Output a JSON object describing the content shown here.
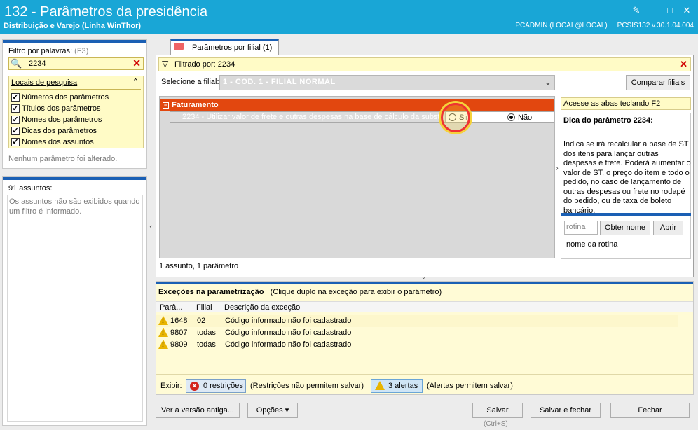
{
  "window": {
    "title": "132 - Parâmetros da presidência",
    "subtitle": "Distribuição e Varejo (Linha WinThor)",
    "user": "PCADMIN (LOCAL@LOCAL)",
    "version": "PCSIS132 v.30.1.04.004",
    "controls": [
      "✎",
      "–",
      "□",
      "✕"
    ]
  },
  "sidebar": {
    "filter_label": "Filtro por palavras:",
    "filter_shortcut": "(F3)",
    "search_value": "2234",
    "locais_title": "Locais de pesquisa",
    "locais": [
      {
        "label": "Números dos parâmetros",
        "checked": true
      },
      {
        "label": "Títulos dos parâmetros",
        "checked": true
      },
      {
        "label": "Nomes dos parâmetros",
        "checked": true
      },
      {
        "label": "Dicas dos parâmetros",
        "checked": true
      },
      {
        "label": "Nomes dos assuntos",
        "checked": true
      }
    ],
    "nenhum": "Nenhum parâmetro foi alterado.",
    "assuntos_count": "91 assuntos:",
    "assuntos_msg": "Os assuntos não são exibidos quando um filtro é informado."
  },
  "tab": {
    "label": "Parâmetros por filial  (1)"
  },
  "main": {
    "filtered": "Filtrado por: 2234",
    "filial_label": "Selecione a filial:",
    "filial_value": "1 - COD. 1 - FILIAL NORMAL",
    "compare_button": "Comparar filiais",
    "group_name": "Faturamento",
    "param_text": "2234 - Utilizar valor de frete e outras despesas na base de cálculo da substituição tributária",
    "option_sim": "Sim",
    "option_nao": "Não",
    "selected": "Não",
    "counts": "1 assunto, 1 parâmetro"
  },
  "dica": {
    "shortcut": "Acesse as abas teclando F2",
    "title": "Dica do parâmetro 2234:",
    "text": "Indica se irá recalcular a base de ST dos itens para lançar outras despesas e frete. Poderá aumentar o valor de ST, o preço do item e todo o pedido, no caso de lançamento de outras despesas ou frete no rodapé do pedido, ou de taxa de boleto bancário.",
    "rotina_placeholder": "rotina",
    "obter_button": "Obter nome",
    "abrir_button": "Abrir",
    "rotina_name": "nome da rotina"
  },
  "exceptions": {
    "title": "Exceções na parametrização",
    "hint": "(Clique duplo na exceção para exibir o parâmetro)",
    "columns": [
      "Parâ...",
      "Filial",
      "Descrição da exceção"
    ],
    "rows": [
      {
        "param": "1648",
        "filial": "02",
        "desc": "Código informado não foi cadastrado"
      },
      {
        "param": "9807",
        "filial": "todas",
        "desc": "Código informado não foi cadastrado"
      },
      {
        "param": "9809",
        "filial": "todas",
        "desc": "Código informado não foi cadastrado"
      }
    ],
    "exibir_label": "Exibir:",
    "restricoes_button": "0 restrições",
    "restricoes_note": "(Restrições não permitem salvar)",
    "alertas_button": "3 alertas",
    "alertas_note": "(Alertas permitem salvar)"
  },
  "footer": {
    "old_version_button": "Ver a versão antiga...",
    "options_button": "Opções ▾",
    "save_button": "Salvar",
    "save_shortcut": "(Ctrl+S)",
    "save_close_button": "Salvar e fechar",
    "close_button": "Fechar"
  },
  "colors": {
    "titlebar": "#19a6d6",
    "accent": "#1a5fb4",
    "group": "#e2470f",
    "highlight": "#fffbc6"
  }
}
